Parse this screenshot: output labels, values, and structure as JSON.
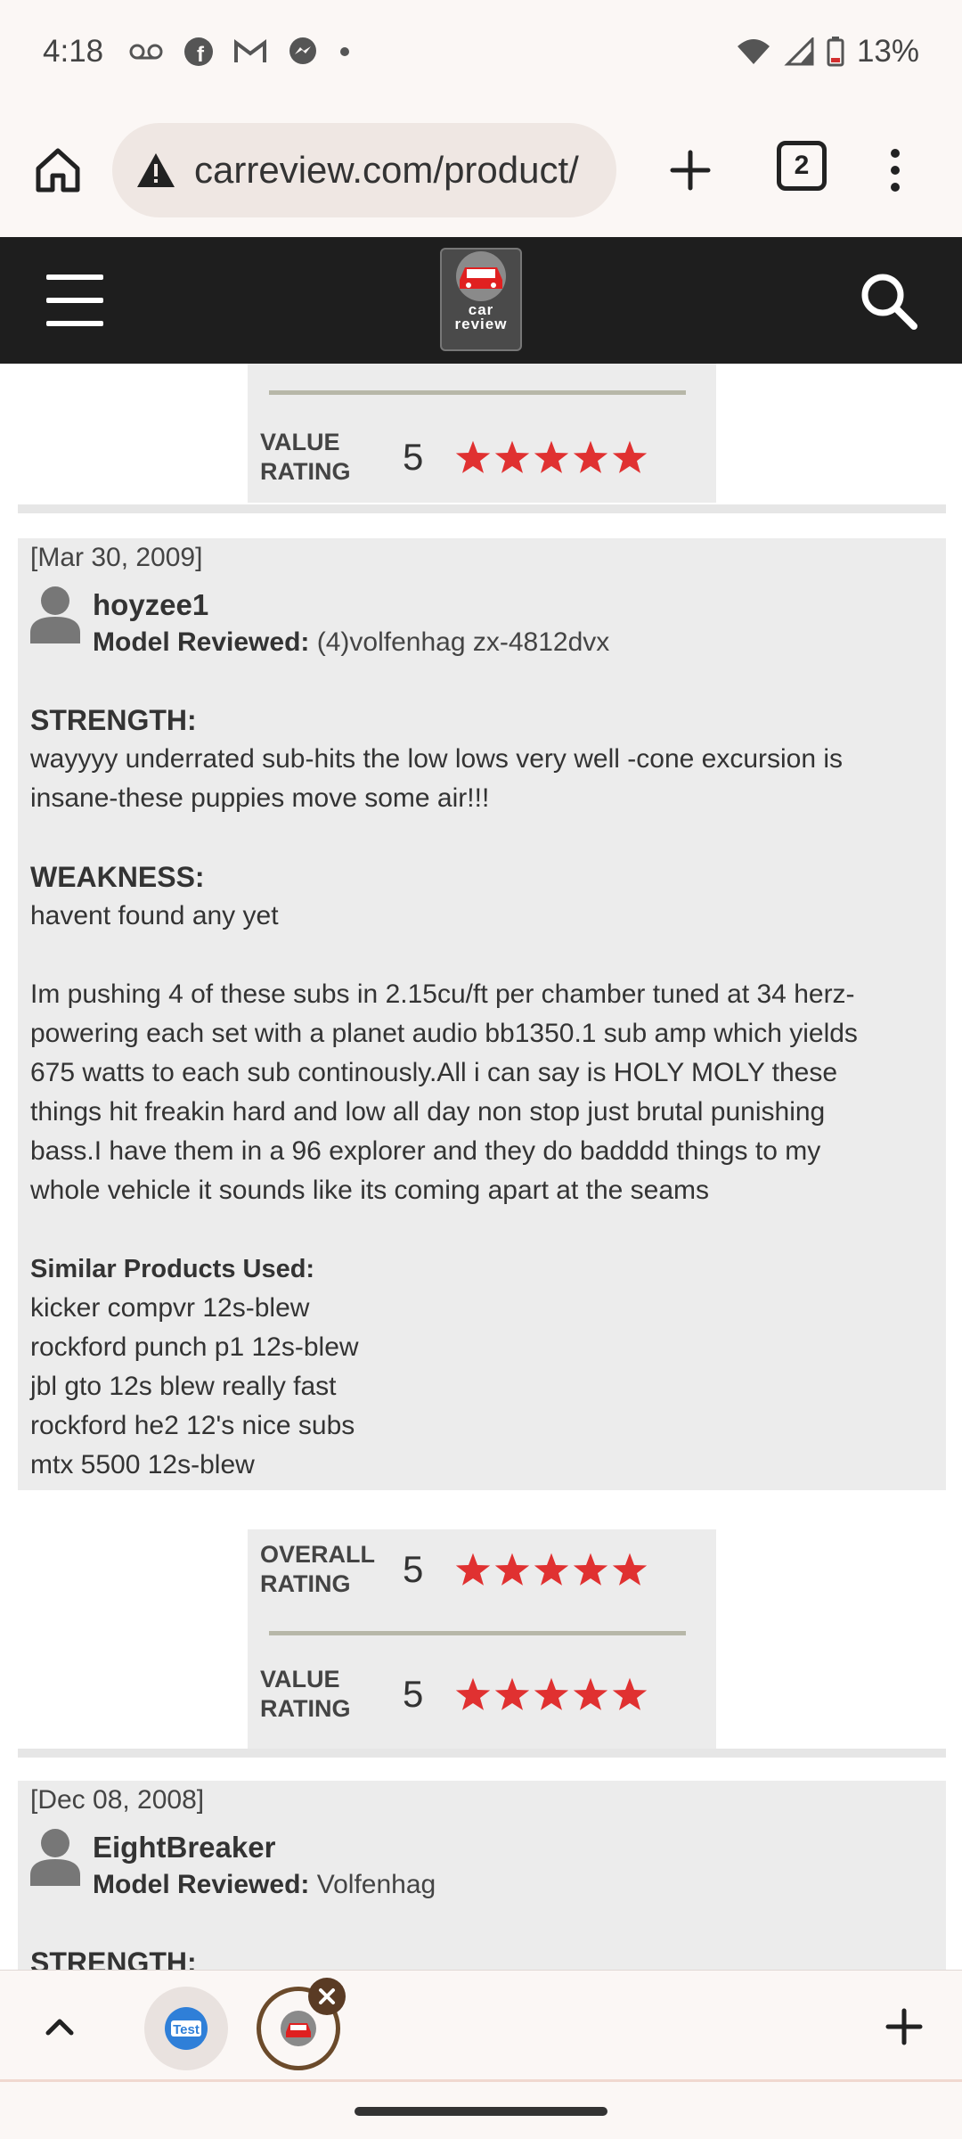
{
  "status_bar": {
    "time": "4:18",
    "battery": "13%",
    "icons": [
      "voicemail-icon",
      "facebook-icon",
      "gmail-icon",
      "messenger-icon",
      "dot-icon",
      "wifi-icon",
      "signal-icon",
      "battery-icon"
    ]
  },
  "browser": {
    "url": "carreview.com/product/",
    "tab_count": "2"
  },
  "site": {
    "logo_line1": "car",
    "logo_line2": "review"
  },
  "top_rating": {
    "value_label_line1": "VALUE",
    "value_label_line2": "RATING",
    "value_score": "5"
  },
  "review1": {
    "date": "[Mar 30, 2009]",
    "username": "hoyzee1",
    "model_label": "Model Reviewed:",
    "model_value": "(4)volfenhag zx-4812dvx",
    "strength_title": "STRENGTH:",
    "strength_lines": [
      "wayyyy underrated sub-hits the low lows very well -cone excursion is",
      "insane-these puppies move some air!!!"
    ],
    "weakness_title": "WEAKNESS:",
    "weakness_text": "havent found any yet",
    "body_lines": [
      "Im pushing 4 of these subs in 2.15cu/ft per chamber tuned at 34 herz-",
      "powering each set with a planet audio bb1350.1 sub amp which yields",
      "675 watts to each sub continously.All i can say is HOLY MOLY these",
      "things hit freakin hard and low all day non stop just brutal punishing",
      "bass.I have them in a 96 explorer and they do badddd things to my",
      "whole vehicle it sounds like its coming apart at the seams"
    ],
    "similar_title": "Similar Products Used:",
    "similar_items": [
      "kicker compvr 12s-blew",
      "rockford punch p1 12s-blew",
      "jbl gto 12s blew really fast",
      "rockford he2 12's nice subs",
      "mtx 5500 12s-blew"
    ],
    "overall_label_line1": "OVERALL",
    "overall_label_line2": "RATING",
    "overall_score": "5",
    "overall_stars": 5,
    "value_label_line1": "VALUE",
    "value_label_line2": "RATING",
    "value_score": "5",
    "value_stars": 5
  },
  "review2": {
    "date": "[Dec 08, 2008]",
    "username": "EightBreaker",
    "model_label": "Model Reviewed:",
    "model_value": "Volfenhag",
    "strength_title": "STRENGTH:"
  },
  "colors": {
    "star": "#e03131",
    "header_bg": "#1e1e1e",
    "review_bg": "#ececec"
  }
}
